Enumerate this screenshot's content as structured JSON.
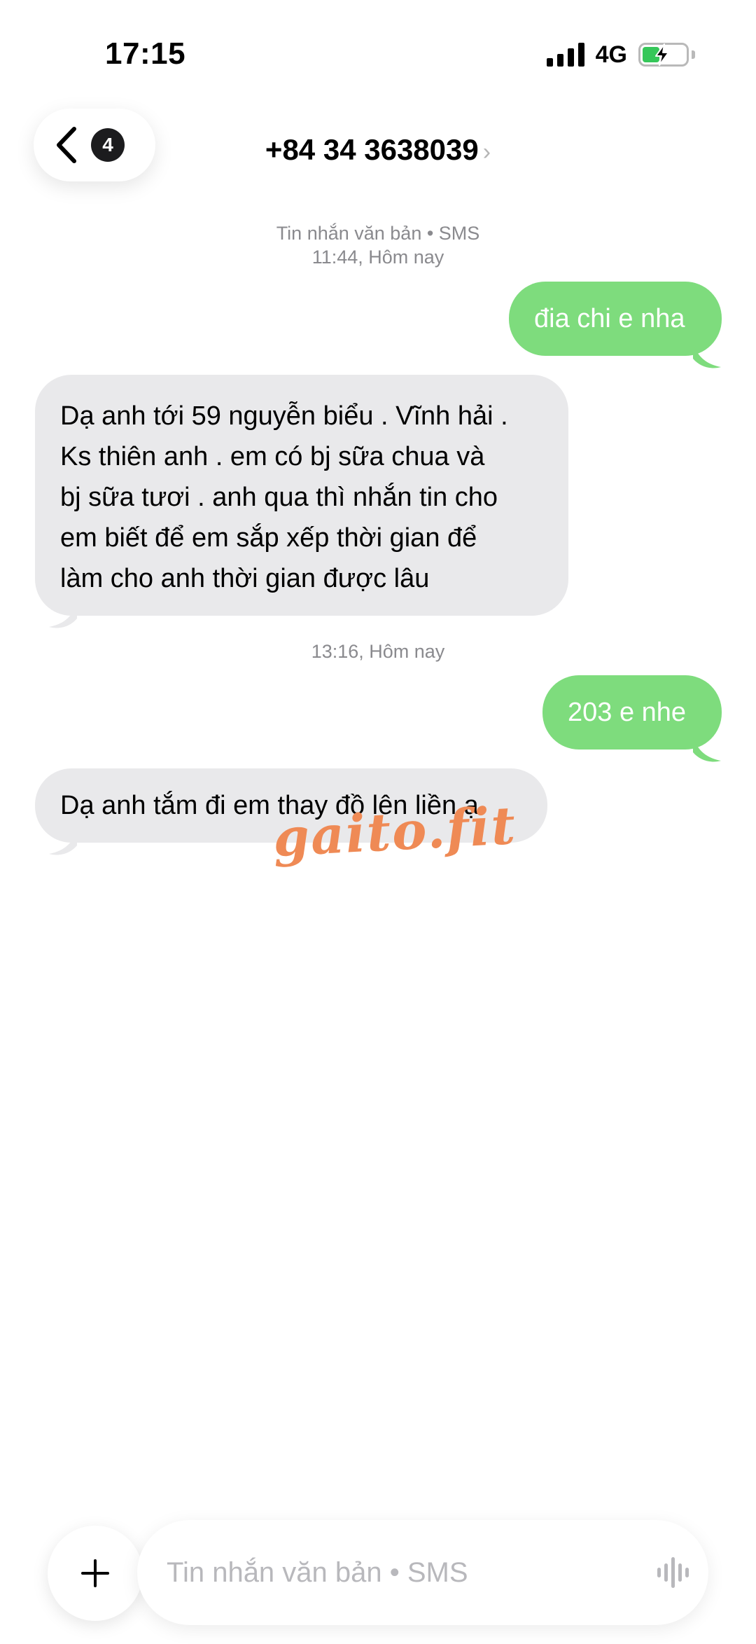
{
  "status_bar": {
    "time": "17:15",
    "network": "4G",
    "signal_bars": 4,
    "battery_charging": true,
    "battery_level": 0.4
  },
  "header": {
    "back_badge": "4",
    "contact": "+84 34 3638039",
    "chevron": "›"
  },
  "conversation": {
    "stamp1_type": "Tin nhắn văn bản • SMS",
    "stamp1_time": "11:44, Hôm nay",
    "msg1": "đia chi e nha",
    "msg2_lines": [
      "Dạ anh tới 59 nguyễn biểu . Vĩnh hải .",
      "Ks thiên anh . em có bj sữa chua và",
      "bj sữa tươi . anh qua thì  nhắn tin cho",
      "em biết để em sắp xếp thời gian để",
      "làm cho anh thời gian được lâu"
    ],
    "stamp2_time": "13:16, Hôm nay",
    "msg3": "203 e nhe",
    "msg4": "Dạ anh tắm đi em thay đồ lên liền ạ"
  },
  "watermark": "gaito.fit",
  "composer": {
    "placeholder": "Tin nhắn văn bản • SMS"
  },
  "colors": {
    "outgoing_bubble": "#7edc7d",
    "incoming_bubble": "#e9e9eb",
    "timestamp": "#8a8a8e",
    "watermark": "#ef8a55"
  },
  "icons": [
    "back-chevron-icon",
    "signal-icon",
    "battery-charging-icon",
    "plus-icon",
    "audio-waveform-icon"
  ]
}
